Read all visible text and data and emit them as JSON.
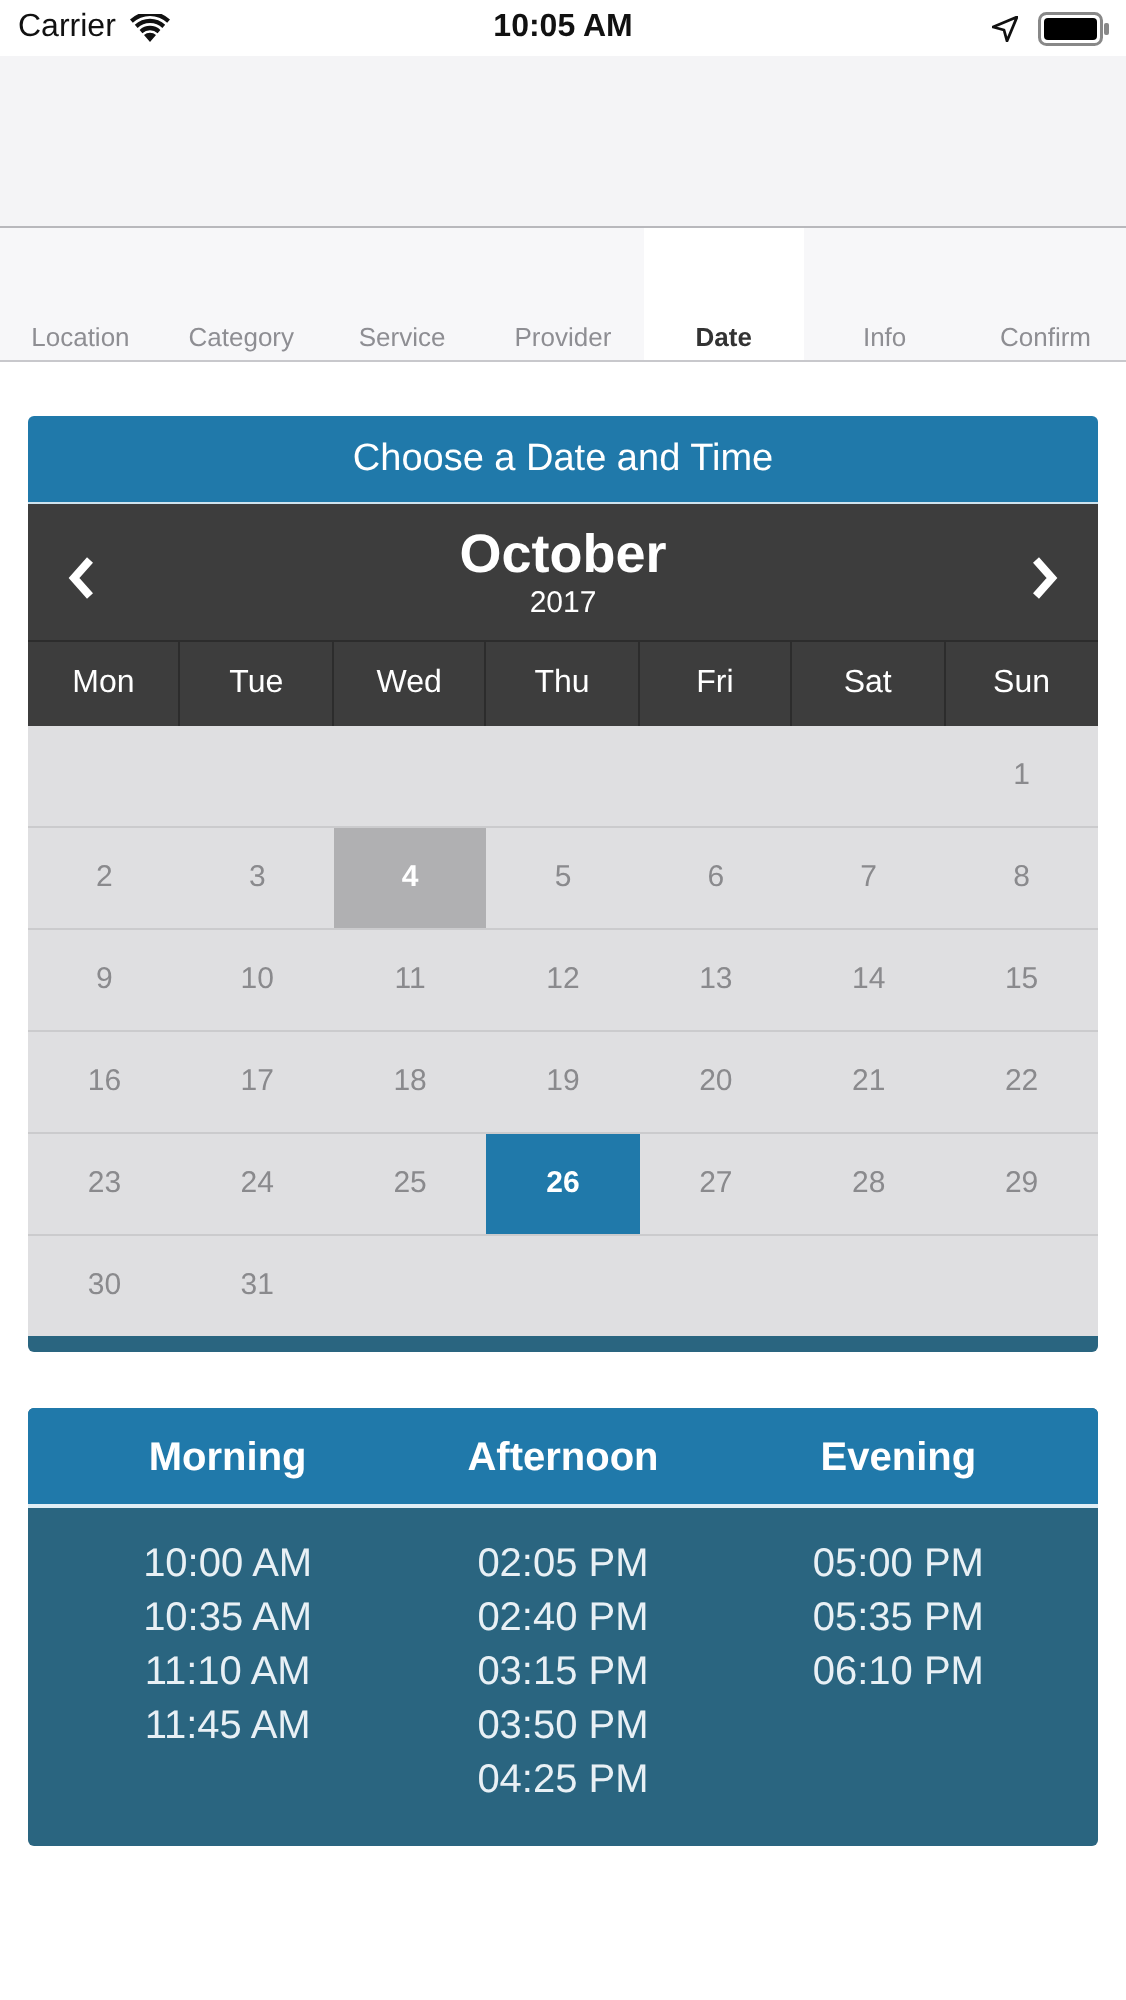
{
  "status_bar": {
    "carrier": "Carrier",
    "time": "10:05 AM"
  },
  "steps": [
    {
      "label": "Location",
      "selected": false
    },
    {
      "label": "Category",
      "selected": false
    },
    {
      "label": "Service",
      "selected": false
    },
    {
      "label": "Provider",
      "selected": false
    },
    {
      "label": "Date",
      "selected": true
    },
    {
      "label": "Info",
      "selected": false
    },
    {
      "label": "Confirm",
      "selected": false
    }
  ],
  "calendar": {
    "title": "Choose a Date and Time",
    "month": "October",
    "year": "2017",
    "weekdays": [
      "Mon",
      "Tue",
      "Wed",
      "Thu",
      "Fri",
      "Sat",
      "Sun"
    ],
    "weeks": [
      [
        {
          "kind": "empty"
        },
        {
          "kind": "empty"
        },
        {
          "kind": "empty"
        },
        {
          "kind": "empty"
        },
        {
          "kind": "empty"
        },
        {
          "kind": "empty"
        },
        {
          "kind": "day",
          "day": "1",
          "today": false,
          "selected": false
        }
      ],
      [
        {
          "kind": "day",
          "day": "2",
          "today": false,
          "selected": false
        },
        {
          "kind": "day",
          "day": "3",
          "today": false,
          "selected": false
        },
        {
          "kind": "day",
          "day": "4",
          "today": true,
          "selected": false
        },
        {
          "kind": "day",
          "day": "5",
          "today": false,
          "selected": false
        },
        {
          "kind": "day",
          "day": "6",
          "today": false,
          "selected": false
        },
        {
          "kind": "day",
          "day": "7",
          "today": false,
          "selected": false
        },
        {
          "kind": "day",
          "day": "8",
          "today": false,
          "selected": false
        }
      ],
      [
        {
          "kind": "day",
          "day": "9",
          "today": false,
          "selected": false
        },
        {
          "kind": "day",
          "day": "10",
          "today": false,
          "selected": false
        },
        {
          "kind": "day",
          "day": "11",
          "today": false,
          "selected": false
        },
        {
          "kind": "day",
          "day": "12",
          "today": false,
          "selected": false
        },
        {
          "kind": "day",
          "day": "13",
          "today": false,
          "selected": false
        },
        {
          "kind": "day",
          "day": "14",
          "today": false,
          "selected": false
        },
        {
          "kind": "day",
          "day": "15",
          "today": false,
          "selected": false
        }
      ],
      [
        {
          "kind": "day",
          "day": "16",
          "today": false,
          "selected": false
        },
        {
          "kind": "day",
          "day": "17",
          "today": false,
          "selected": false
        },
        {
          "kind": "day",
          "day": "18",
          "today": false,
          "selected": false
        },
        {
          "kind": "day",
          "day": "19",
          "today": false,
          "selected": false
        },
        {
          "kind": "day",
          "day": "20",
          "today": false,
          "selected": false
        },
        {
          "kind": "day",
          "day": "21",
          "today": false,
          "selected": false
        },
        {
          "kind": "day",
          "day": "22",
          "today": false,
          "selected": false
        }
      ],
      [
        {
          "kind": "day",
          "day": "23",
          "today": false,
          "selected": false
        },
        {
          "kind": "day",
          "day": "24",
          "today": false,
          "selected": false
        },
        {
          "kind": "day",
          "day": "25",
          "today": false,
          "selected": false
        },
        {
          "kind": "day",
          "day": "26",
          "today": false,
          "selected": true
        },
        {
          "kind": "day",
          "day": "27",
          "today": false,
          "selected": false
        },
        {
          "kind": "day",
          "day": "28",
          "today": false,
          "selected": false
        },
        {
          "kind": "day",
          "day": "29",
          "today": false,
          "selected": false
        }
      ],
      [
        {
          "kind": "day",
          "day": "30",
          "today": false,
          "selected": false
        },
        {
          "kind": "day",
          "day": "31",
          "today": false,
          "selected": false
        },
        {
          "kind": "empty"
        },
        {
          "kind": "empty"
        },
        {
          "kind": "empty"
        },
        {
          "kind": "empty"
        },
        {
          "kind": "empty"
        }
      ]
    ]
  },
  "times": {
    "columns": [
      {
        "heading": "Morning",
        "slots": [
          "10:00 AM",
          "10:35 AM",
          "11:10 AM",
          "11:45 AM"
        ]
      },
      {
        "heading": "Afternoon",
        "slots": [
          "02:05 PM",
          "02:40 PM",
          "03:15 PM",
          "03:50 PM",
          "04:25 PM"
        ]
      },
      {
        "heading": "Evening",
        "slots": [
          "05:00 PM",
          "05:35 PM",
          "06:10 PM"
        ]
      }
    ]
  }
}
